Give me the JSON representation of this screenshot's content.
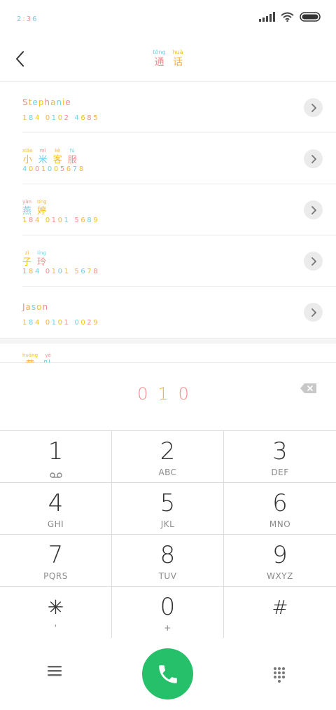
{
  "status_bar": {
    "time": "2:36",
    "icons": [
      "signal-icon",
      "wifi-icon",
      "battery-icon"
    ]
  },
  "header": {
    "back_icon": "chevron-left-icon",
    "title": [
      {
        "pinyin": "tōng",
        "char": "通"
      },
      {
        "pinyin": "huà",
        "char": "话"
      }
    ]
  },
  "contacts": [
    {
      "name": "Stephanie",
      "number": "184 0102 4685"
    },
    {
      "name_ruby": [
        {
          "pinyin": "xiǎo",
          "char": "小"
        },
        {
          "pinyin": "mǐ",
          "char": "米"
        },
        {
          "pinyin": "kè",
          "char": "客"
        },
        {
          "pinyin": "fú",
          "char": "服"
        }
      ],
      "number": "4001005678"
    },
    {
      "name_ruby": [
        {
          "pinyin": "yàn",
          "char": "燕"
        },
        {
          "pinyin": "tíng",
          "char": "婷"
        }
      ],
      "number": "184 0101 5689"
    },
    {
      "name_ruby": [
        {
          "pinyin": "zǐ",
          "char": "子"
        },
        {
          "pinyin": "líng",
          "char": "玲"
        }
      ],
      "number": "184 0101 5678"
    },
    {
      "name": "Jason",
      "number": "184 0101 0029"
    }
  ],
  "partial_contact": {
    "name_ruby": [
      {
        "pinyin": "huáng",
        "char": "黄"
      },
      {
        "pinyin": "yè",
        "char": "叶"
      }
    ]
  },
  "dial_input": {
    "digits": [
      "0",
      "1",
      "0"
    ]
  },
  "keypad": [
    {
      "digit": "1",
      "letters": "",
      "sub_icon": "voicemail-icon"
    },
    {
      "digit": "2",
      "letters": "ABC"
    },
    {
      "digit": "3",
      "letters": "DEF"
    },
    {
      "digit": "4",
      "letters": "GHI"
    },
    {
      "digit": "5",
      "letters": "JKL"
    },
    {
      "digit": "6",
      "letters": "MNO"
    },
    {
      "digit": "7",
      "letters": "PQRS"
    },
    {
      "digit": "8",
      "letters": "TUV"
    },
    {
      "digit": "9",
      "letters": "WXYZ"
    },
    {
      "digit": "✳",
      "letters": "'"
    },
    {
      "digit": "0",
      "letters": "+"
    },
    {
      "digit": "#",
      "letters": ""
    }
  ],
  "bottom_bar": {
    "menu_icon": "menu-icon",
    "call_icon": "phone-icon",
    "dialpad_icon": "dialpad-icon"
  },
  "colors": {
    "call_green": "#26bf6a",
    "pink": "#f78c8c",
    "orange": "#f7b24a",
    "cyan": "#6fd0e8",
    "yellow": "#f2c21b"
  }
}
